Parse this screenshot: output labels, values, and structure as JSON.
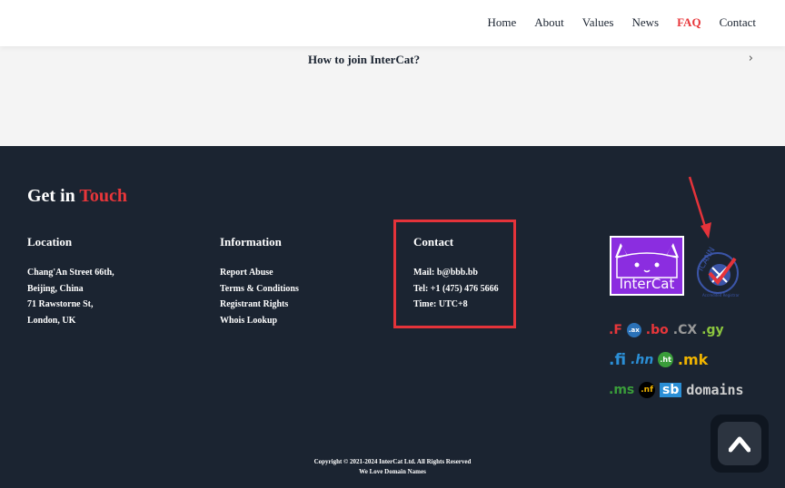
{
  "nav": {
    "items": [
      {
        "label": "Home",
        "active": false
      },
      {
        "label": "About",
        "active": false
      },
      {
        "label": "Values",
        "active": false
      },
      {
        "label": "News",
        "active": false
      },
      {
        "label": "FAQ",
        "active": true
      },
      {
        "label": "Contact",
        "active": false
      }
    ]
  },
  "faq": {
    "question": "How to join InterCat?",
    "chevron_icon": "chevron-right-icon"
  },
  "footer": {
    "heading_main": "Get in",
    "heading_accent": "Touch",
    "location": {
      "title": "Location",
      "lines": [
        "Chang'An Street 66th,",
        "Beijing, China",
        "71 Rawstorne St,",
        "London, UK"
      ]
    },
    "information": {
      "title": "Information",
      "links": [
        "Report Abuse",
        "Terms & Conditions",
        "Registrant Rights",
        "Whois Lookup"
      ]
    },
    "contact": {
      "title": "Contact",
      "mail": "Mail: b@bbb.bb",
      "tel": "Tel: +1 (475) 476 5666",
      "time": "Time: UTC+8"
    },
    "logo_text": "InterCat",
    "icann_text": "ICANN",
    "icann_sub": "Accredited Registrar",
    "tlds": {
      "row1": [
        ".F",
        ".ax",
        ".bo",
        ".CX",
        ".gy"
      ],
      "row2": [
        ".fi",
        ".hn",
        ".ht",
        ".mk"
      ],
      "row3": [
        ".ms",
        ".nf",
        "sb",
        "domains"
      ]
    },
    "copyright": "Copyright © 2021-2024 InterCat Ltd. All Rights Reserved",
    "tagline": "We Love Domain Names"
  },
  "colors": {
    "accent": "#e8363a",
    "footer_bg": "#1b2431",
    "logo_bg": "#8b2de0"
  }
}
